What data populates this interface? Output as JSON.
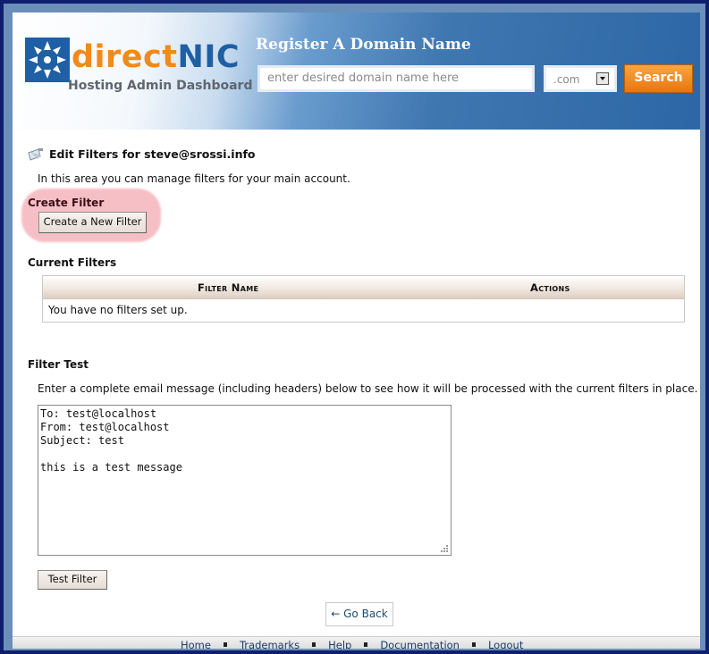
{
  "header": {
    "logo_direct": "direct",
    "logo_nic": "NIC",
    "logo_subtitle": "Hosting Admin Dashboard",
    "register_title": "Register A Domain Name",
    "domain_placeholder": "enter desired domain name here",
    "tld_selected": ".com",
    "search_label": "Search",
    "colors": {
      "brand_orange": "#f08a1a",
      "brand_blue": "#1f5fa3",
      "search_button": "#f0860f"
    }
  },
  "page": {
    "title": "Edit Filters for steve@srossi.info",
    "intro": "In this area you can manage filters for your main account."
  },
  "create_filter": {
    "heading": "Create Filter",
    "button_label": "Create a New Filter"
  },
  "current_filters": {
    "heading": "Current Filters",
    "columns": [
      "Filter Name",
      "Actions"
    ],
    "empty_message": "You have no filters set up."
  },
  "filter_test": {
    "heading": "Filter Test",
    "description": "Enter a complete email message (including headers) below to see how it will be processed with the current filters in place.",
    "message": "To: test@localhost\nFrom: test@localhost\nSubject: test\n\nthis is a test message",
    "button_label": "Test Filter"
  },
  "navigation": {
    "back_label": "← Go Back"
  },
  "footer": {
    "links": [
      "Home",
      "Trademarks",
      "Help",
      "Documentation",
      "Logout"
    ]
  },
  "icons": {
    "logo": "asterisk-logo-icon",
    "page": "mail-filter-icon",
    "dropdown": "chevron-down-icon",
    "resize": "resize-grip-icon"
  }
}
